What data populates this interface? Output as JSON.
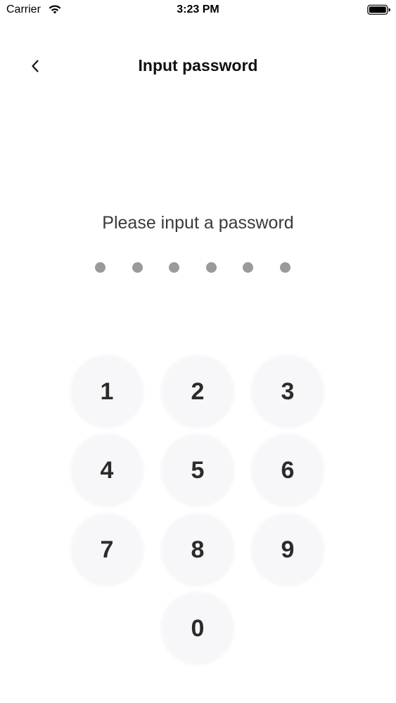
{
  "status_bar": {
    "carrier": "Carrier",
    "time": "3:23 PM",
    "wifi_icon": "wifi-icon",
    "battery_icon": "battery-icon"
  },
  "nav": {
    "back_icon": "chevron-left-icon",
    "title": "Input password"
  },
  "prompt": "Please input a password",
  "password": {
    "length": 6,
    "entered": 0
  },
  "keypad": {
    "keys": [
      "1",
      "2",
      "3",
      "4",
      "5",
      "6",
      "7",
      "8",
      "9",
      "0"
    ]
  },
  "colors": {
    "dot": "#9a9a9a",
    "key_background": "#f7f6f8",
    "key_text": "#2b2b2b"
  }
}
